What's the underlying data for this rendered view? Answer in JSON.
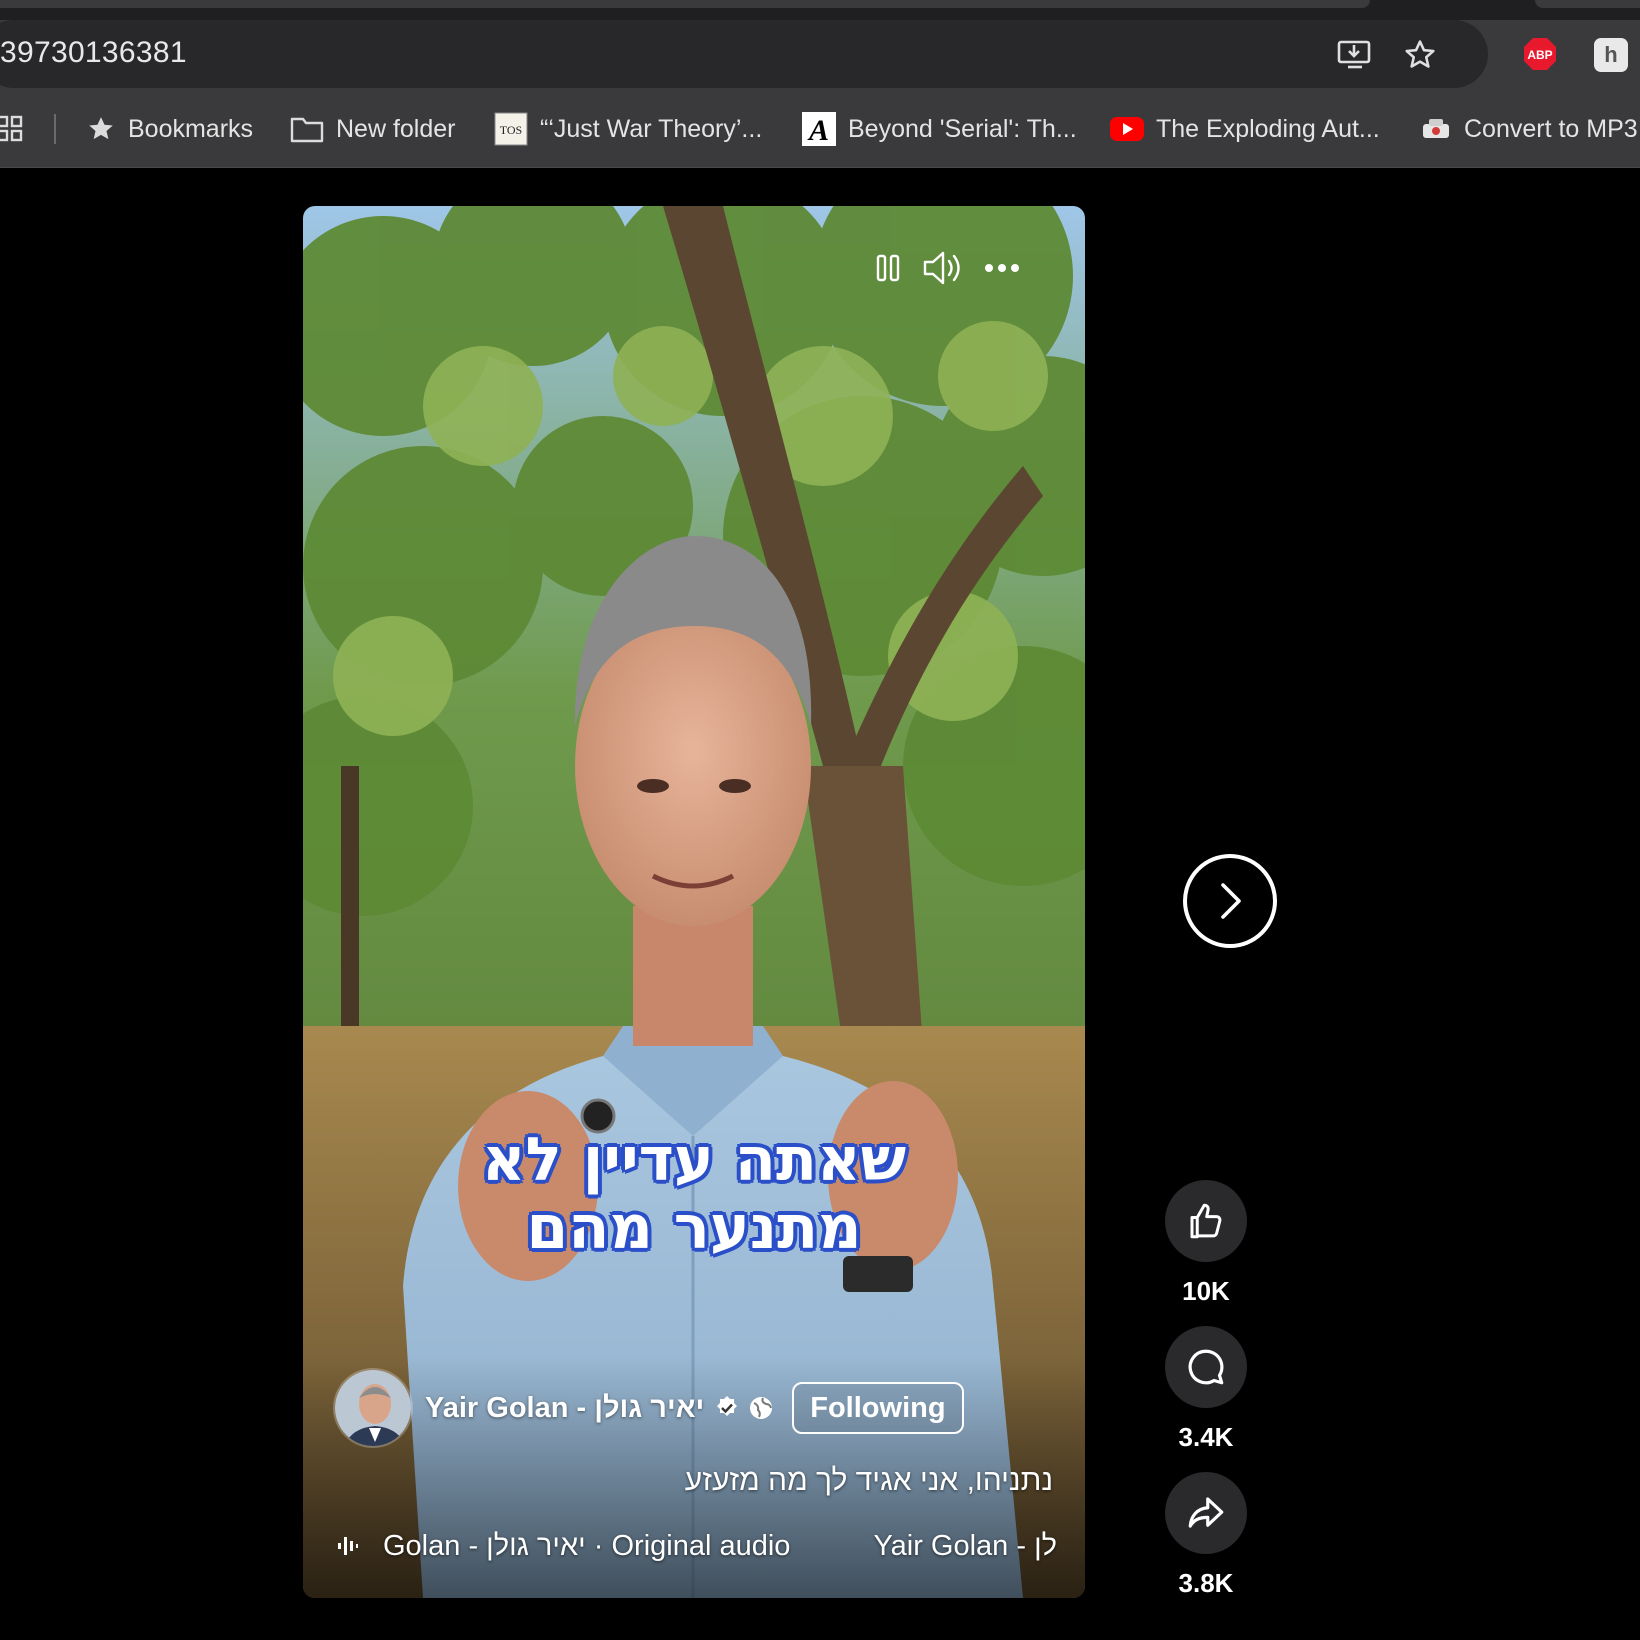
{
  "browser": {
    "url": "39730136381",
    "bookmarks": [
      {
        "label": "Bookmarks",
        "icon": "star-icon"
      },
      {
        "label": "New folder",
        "icon": "folder-icon"
      },
      {
        "label": "“‘Just War Theory’...",
        "icon": "tos-icon"
      },
      {
        "label": "Beyond 'Serial': Th...",
        "icon": "atlantic-icon"
      },
      {
        "label": "The Exploding Aut...",
        "icon": "youtube-icon"
      },
      {
        "label": "Convert to MP3",
        "icon": "converter-icon"
      }
    ],
    "extensions": {
      "abp": "ABP"
    }
  },
  "video": {
    "caption_line1": "שאתה עדיין לא",
    "caption_line2": "מתנער מהם",
    "author": "Yair Golan - יאיר גולן",
    "follow_label": "Following",
    "description": "נתניהו, אני אגיד לך מה מזעזע",
    "audio": "Golan - יאיר גולן · Original audio",
    "audio_tail": "Yair Golan - לן"
  },
  "actions": {
    "likes": "10K",
    "comments": "3.4K",
    "shares": "3.8K"
  },
  "colors": {
    "caption_outline": "#2a4fc8",
    "chrome_bg": "#3a3a3d",
    "abp_red": "#e8192c",
    "youtube_red": "#ff0000"
  }
}
